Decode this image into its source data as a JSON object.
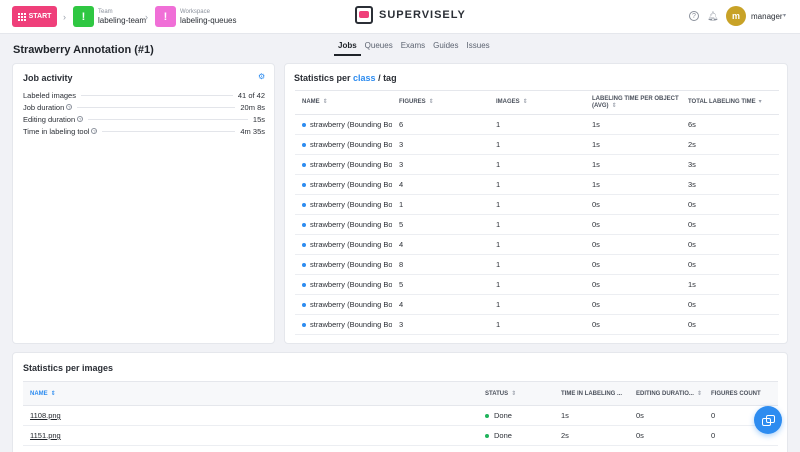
{
  "topbar": {
    "start_label": "START",
    "team": {
      "sub": "Team",
      "name": "labeling-team",
      "initial": "!",
      "color": "#2fc742"
    },
    "workspace": {
      "sub": "Workspace",
      "name": "labeling-queues",
      "initial": "!",
      "color": "#f06fd7"
    },
    "logo_text": "SUPERVISELY",
    "avatar_initial": "m",
    "user_name": "manager"
  },
  "page": {
    "title": "Strawberry Annotation (#1)",
    "tabs": [
      "Jobs",
      "Queues",
      "Exams",
      "Guides",
      "Issues"
    ],
    "active_tab": "Jobs"
  },
  "activity": {
    "title": "Job activity",
    "rows": [
      {
        "label": "Labeled images",
        "value": "41 of 42",
        "help": false
      },
      {
        "label": "Job duration",
        "value": "20m 8s",
        "help": true
      },
      {
        "label": "Editing duration",
        "value": "15s",
        "help": true
      },
      {
        "label": "Time in labeling tool",
        "value": "4m 35s",
        "help": true
      }
    ]
  },
  "stats": {
    "title_prefix": "Statistics per ",
    "title_class": "class",
    "title_suffix": " / tag",
    "headers": [
      "NAME",
      "FIGURES",
      "IMAGES",
      "LABELING TIME PER OBJECT (AVG)",
      "TOTAL LABELING TIME"
    ],
    "rows": [
      [
        "strawberry (Bounding Box)",
        "6",
        "1",
        "1s",
        "6s"
      ],
      [
        "strawberry (Bounding Box)",
        "3",
        "1",
        "1s",
        "2s"
      ],
      [
        "strawberry (Bounding Box)",
        "3",
        "1",
        "1s",
        "3s"
      ],
      [
        "strawberry (Bounding Box)",
        "4",
        "1",
        "1s",
        "3s"
      ],
      [
        "strawberry (Bounding Box)",
        "1",
        "1",
        "0s",
        "0s"
      ],
      [
        "strawberry (Bounding Box)",
        "5",
        "1",
        "0s",
        "0s"
      ],
      [
        "strawberry (Bounding Box)",
        "4",
        "1",
        "0s",
        "0s"
      ],
      [
        "strawberry (Bounding Box)",
        "8",
        "1",
        "0s",
        "0s"
      ],
      [
        "strawberry (Bounding Box)",
        "5",
        "1",
        "0s",
        "1s"
      ],
      [
        "strawberry (Bounding Box)",
        "4",
        "1",
        "0s",
        "0s"
      ],
      [
        "strawberry (Bounding Box)",
        "3",
        "1",
        "0s",
        "0s"
      ]
    ]
  },
  "images": {
    "title": "Statistics per images",
    "headers": [
      "NAME",
      "STATUS",
      "TIME IN LABELING ...",
      "EDITING DURATIO...",
      "FIGURES COUNT"
    ],
    "rows": [
      [
        "1108.png",
        "Done",
        "1s",
        "0s",
        "0"
      ],
      [
        "1151.png",
        "Done",
        "2s",
        "0s",
        "0"
      ]
    ]
  },
  "colors": {
    "accent": "#2d8cf0",
    "start": "#ef3f7a",
    "done": "#21b45c"
  }
}
